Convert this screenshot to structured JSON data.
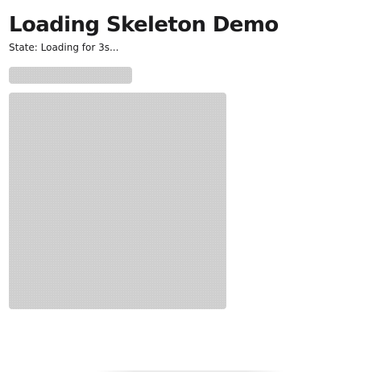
{
  "header": {
    "title": "Loading Skeleton Demo"
  },
  "status": {
    "text": "State: Loading for 3s..."
  },
  "colors": {
    "skeleton": "#cfcfcf",
    "background": "#ffffff",
    "text": "#1c1c1e"
  }
}
